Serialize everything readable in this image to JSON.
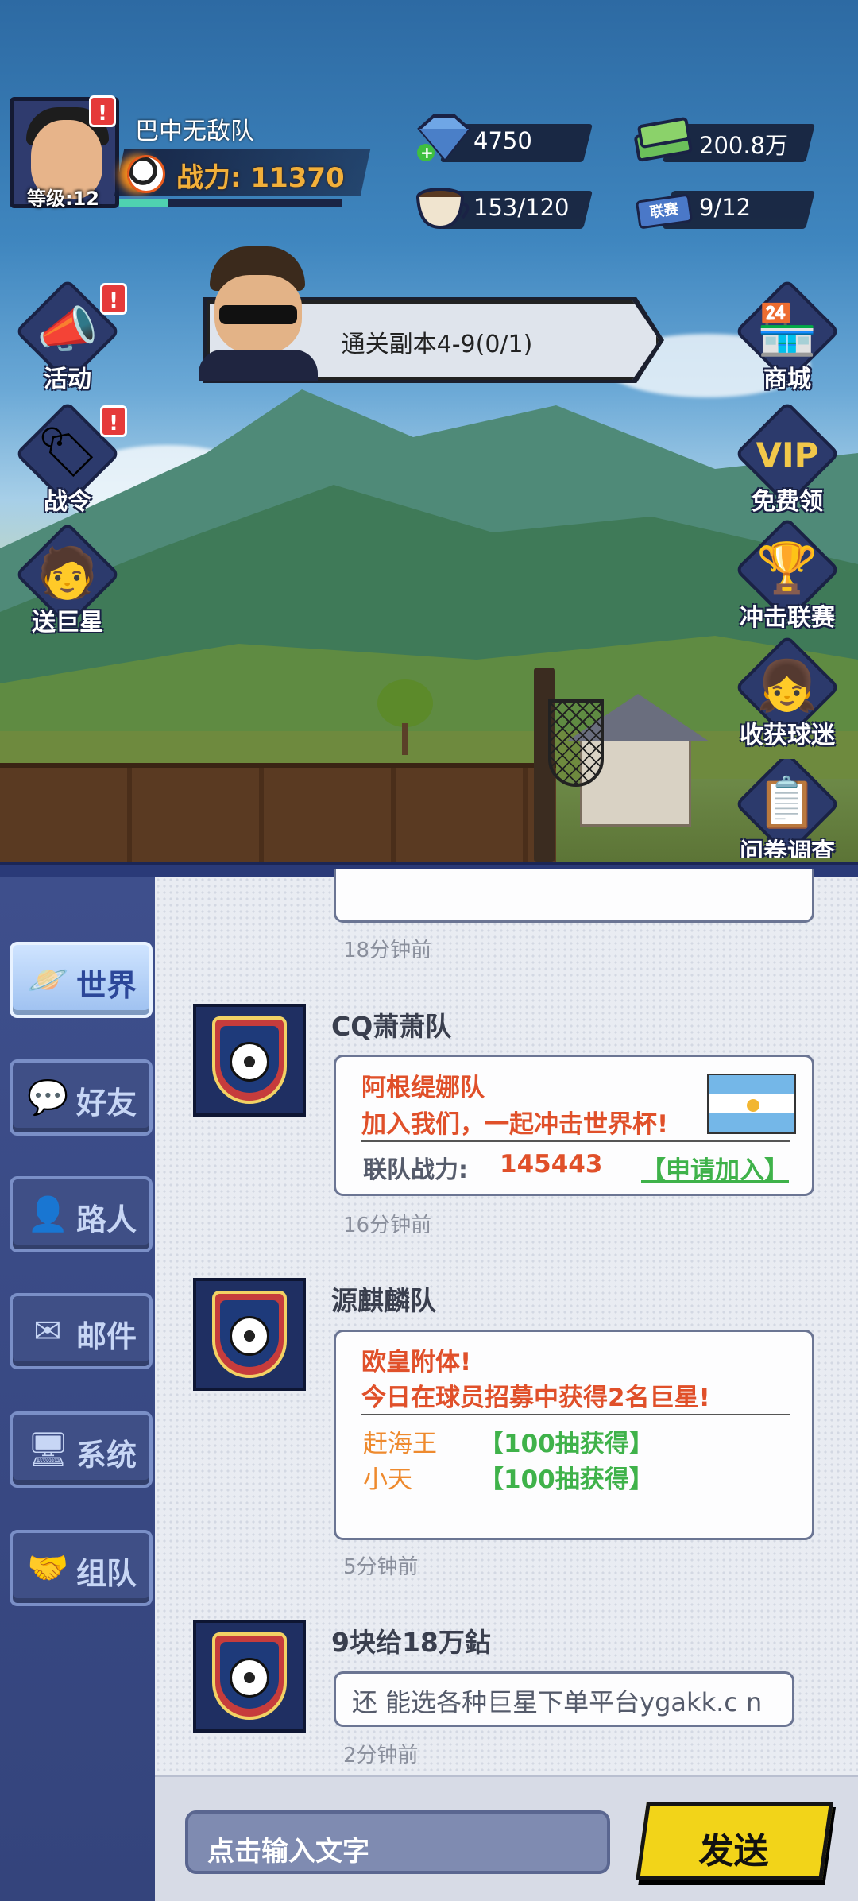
{
  "player": {
    "team_name": "巴中无敌队",
    "level_label": "等级:12",
    "power_label": "战力: 11370",
    "xp_fraction": 0.22
  },
  "resources": {
    "diamonds": "4750",
    "cash": "200.8万",
    "stamina": "153/120",
    "tickets": "9/12",
    "ticket_icon_text": "联赛"
  },
  "alert_mark": "!",
  "quest": {
    "text": "通关副本4-9(0/1)"
  },
  "left_buttons": [
    {
      "label": "活动",
      "icon": "megaphone-icon"
    },
    {
      "label": "战令",
      "icon": "battle-pass-tag-icon"
    },
    {
      "label": "送巨星",
      "icon": "star-player-icon"
    }
  ],
  "right_buttons": [
    {
      "label": "商城",
      "icon": "shop-icon"
    },
    {
      "label": "免费领",
      "icon": "vip-crown-icon",
      "badge_text": "VIP"
    },
    {
      "label": "冲击联赛",
      "icon": "league-icon"
    },
    {
      "label": "收获球迷",
      "icon": "fans-icon"
    },
    {
      "label": "问卷调查",
      "icon": "survey-icon"
    }
  ],
  "tabs": [
    {
      "label": "世界",
      "icon": "planet-icon",
      "active": true
    },
    {
      "label": "好友",
      "icon": "friend-chat-icon",
      "active": false
    },
    {
      "label": "路人",
      "icon": "stranger-icon",
      "active": false
    },
    {
      "label": "邮件",
      "icon": "mail-icon",
      "active": false
    },
    {
      "label": "系统",
      "icon": "system-icon",
      "active": false
    },
    {
      "label": "组队",
      "icon": "handshake-icon",
      "active": false
    }
  ],
  "messages": [
    {
      "time": "18分钟前"
    },
    {
      "sender": "CQ萧萧队",
      "line1": "阿根缇娜队",
      "line2": "加入我们，一起冲击世界杯!",
      "power_label": "联队战力:",
      "power_value": "145443",
      "apply_label": "【申请加入】",
      "time": "16分钟前"
    },
    {
      "sender": "源麒麟队",
      "line1": "欧皇附体!",
      "line2": "今日在球员招募中获得2名巨星!",
      "stars": [
        {
          "name": "赶海王",
          "detail": "【100抽获得】"
        },
        {
          "name": "小天",
          "detail": "【100抽获得】"
        }
      ],
      "time": "5分钟前"
    },
    {
      "sender": "9块给18万鉆",
      "text": "还 能选各种巨星下单平台ygakk.c n",
      "time": "2分钟前"
    }
  ],
  "input": {
    "placeholder": "点击输入文字"
  },
  "send_label": "发送"
}
